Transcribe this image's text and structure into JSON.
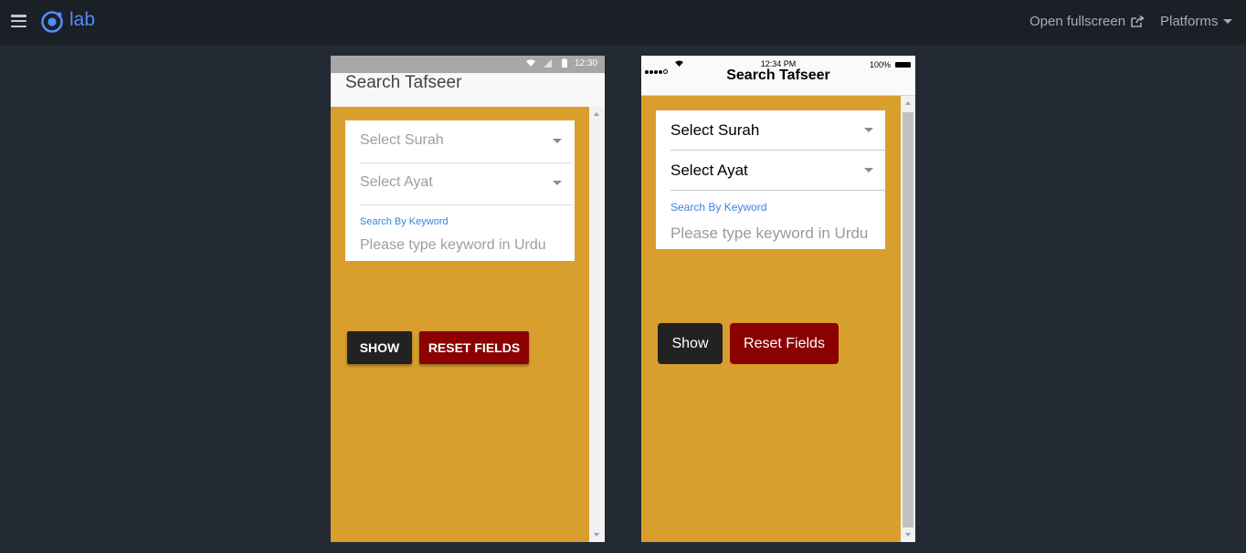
{
  "topbar": {
    "logo_text": "lab",
    "open_fullscreen": "Open fullscreen",
    "platforms": "Platforms"
  },
  "android": {
    "status_time": "12:30",
    "title": "Search Tafseer",
    "select_surah": "Select Surah",
    "select_ayat": "Select Ayat",
    "keyword_label": "Search By Keyword",
    "keyword_placeholder": "Please type keyword in Urdu",
    "show_button": "SHOW",
    "reset_button": "RESET FIELDS"
  },
  "ios": {
    "status_time": "12:34 PM",
    "battery": "100%",
    "title": "Search Tafseer",
    "select_surah": "Select Surah",
    "select_ayat": "Select Ayat",
    "keyword_label": "Search By Keyword",
    "keyword_placeholder": "Please type keyword in Urdu",
    "show_button": "Show",
    "reset_button": "Reset Fields"
  },
  "colors": {
    "content_bg": "#d99f2e",
    "show_button_bg": "#222222",
    "reset_button_bg": "#8b0000",
    "accent": "#4f8ef7",
    "keyword_label": "#3b82e0"
  },
  "icons": [
    "hamburger-icon",
    "ionic-logo-icon",
    "external-link-icon",
    "chevron-down-icon",
    "wifi-icon",
    "signal-icon",
    "battery-icon"
  ]
}
